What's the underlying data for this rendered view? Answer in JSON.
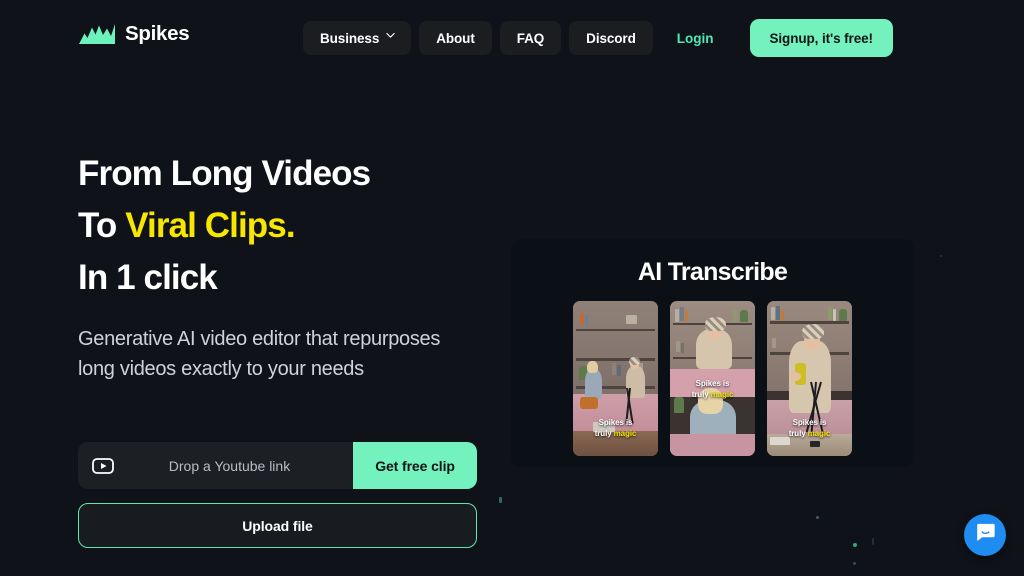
{
  "brand": {
    "name": "Spikes",
    "logo_icon": "spikes-chart-logo-icon",
    "logo_color": "#6ef2bb"
  },
  "nav": {
    "items": [
      {
        "label": "Business",
        "type": "dropdown",
        "icon": "chevron-down-icon"
      },
      {
        "label": "About",
        "type": "pill"
      },
      {
        "label": "FAQ",
        "type": "pill"
      },
      {
        "label": "Discord",
        "type": "pill"
      }
    ],
    "login_label": "Login",
    "login_color": "#4ee9b5",
    "signup_label": "Signup, it's free!",
    "signup_bg": "#73f2bd"
  },
  "hero": {
    "headline_line1": "From Long Videos",
    "headline_line2_prefix": "To ",
    "headline_line2_accent": "Viral Clips.",
    "headline_accent_color": "#f7e600",
    "headline_line3": "In 1 click",
    "subtitle": "Generative AI video editor that repurposes long videos exactly to your needs"
  },
  "cta": {
    "youtube_icon": "youtube-play-icon",
    "link_placeholder": "Drop a Youtube link",
    "link_value": "",
    "get_clip_label": "Get free clip",
    "upload_label": "Upload file",
    "accent_color": "#73f2bd",
    "upload_border_color": "#5fe8ae"
  },
  "demo": {
    "title": "AI Transcribe",
    "caption_line1": "Spikes is",
    "caption_line2_prefix": "truly ",
    "caption_line2_highlight": "magic",
    "caption_highlight_color": "#f5e400",
    "thumbnails": [
      {
        "name": "wide-shot-two-women-on-couch",
        "caption_position": "bottom"
      },
      {
        "name": "split-shot-headscarf-and-blonde",
        "caption_position": "middle"
      },
      {
        "name": "close-shot-woman-gesturing-with-tripod",
        "caption_position": "bottom"
      }
    ]
  },
  "chat": {
    "icon": "intercom-speech-bubble-icon",
    "color": "#1e8cf0"
  }
}
